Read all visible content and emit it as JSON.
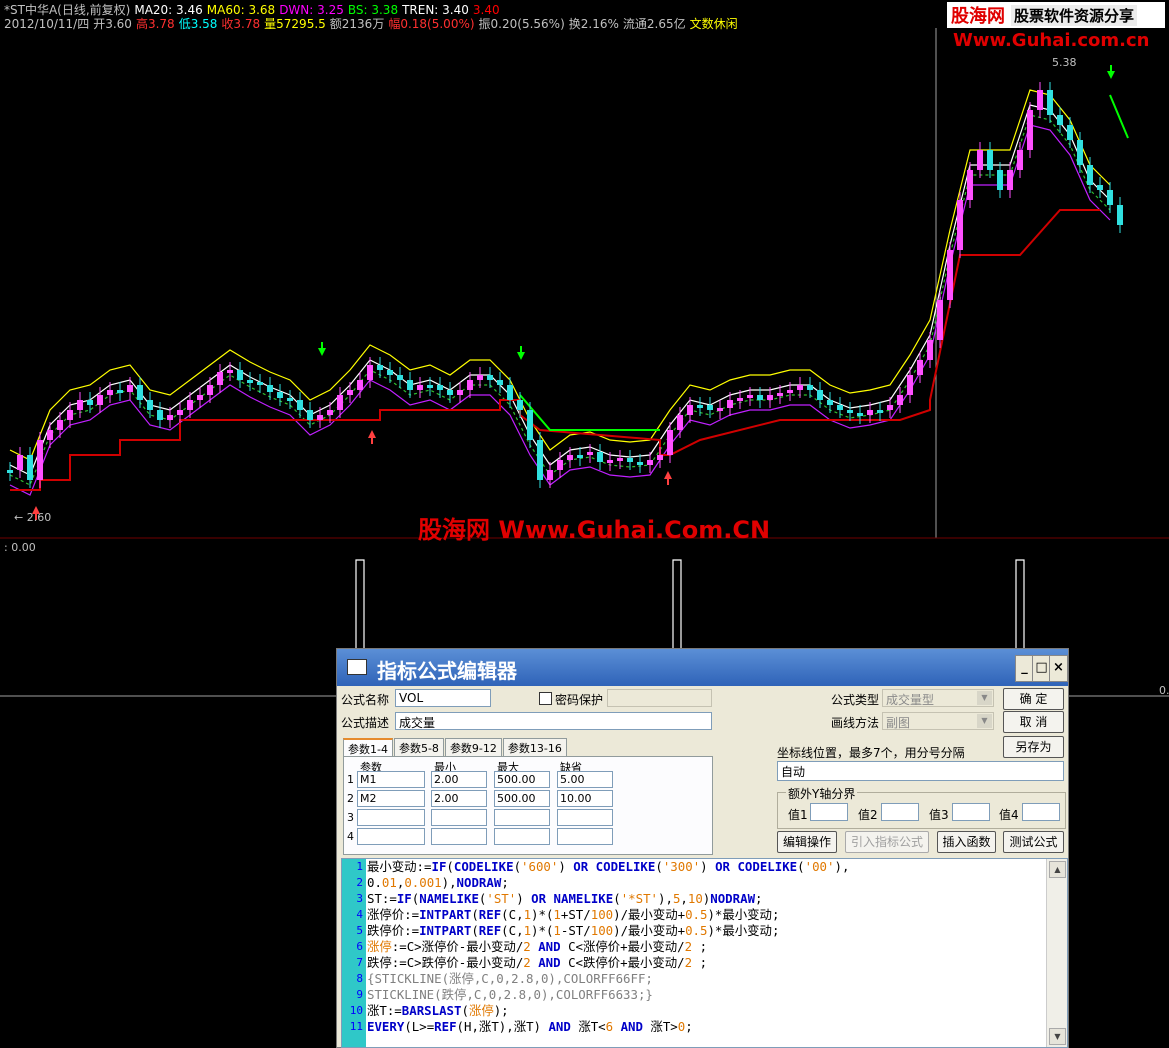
{
  "info_row1": [
    {
      "text": "*ST中华A(日线,前复权)",
      "color": "#c0c0c0"
    },
    {
      "text": "MA20: 3.46",
      "color": "#ffffff"
    },
    {
      "text": "MA60: 3.68",
      "color": "#ffff00"
    },
    {
      "text": "DWN: 3.25",
      "color": "#ff00ff"
    },
    {
      "text": "BS: 3.38",
      "color": "#00ff00"
    },
    {
      "text": "TREN: 3.40",
      "color": "#ffffff"
    },
    {
      "text": "3.40",
      "color": "#ff0000"
    }
  ],
  "info_row2": [
    {
      "text": "2012/10/11/四",
      "color": "#c0c0c0"
    },
    {
      "text": "开3.60",
      "color": "#c0c0c0"
    },
    {
      "text": "高3.78",
      "color": "#ff3030"
    },
    {
      "text": "低3.58",
      "color": "#00ffff"
    },
    {
      "text": "收3.78",
      "color": "#ff3030"
    },
    {
      "text": "量57295.5",
      "color": "#ffff00"
    },
    {
      "text": "额2136万",
      "color": "#c0c0c0"
    },
    {
      "text": "幅0.18(5.00%)",
      "color": "#ff3030"
    },
    {
      "text": "振0.20(5.56%)",
      "color": "#c0c0c0"
    },
    {
      "text": "换2.16%",
      "color": "#c0c0c0"
    },
    {
      "text": "流通2.65亿",
      "color": "#c0c0c0"
    },
    {
      "text": "文数休闲",
      "color": "#ffff00"
    }
  ],
  "brand": {
    "name": "股海网",
    "slogan": "股票软件资源分享",
    "url": "Www.Guhai.com.cn"
  },
  "watermark": "股海网 Www.Guhai.Com.CN",
  "price_high_label": "5.38",
  "price_low_label": "← 2.60",
  "sub_chart_label": ": 0.00",
  "sub_chart_right_label": "0.",
  "dialog": {
    "title": "指标公式编辑器",
    "min_btn": "_",
    "max_btn": "□",
    "close_btn": "×",
    "formula_name_label": "公式名称",
    "formula_name": "VOL",
    "password_label": "密码保护",
    "formula_desc_label": "公式描述",
    "formula_desc": "成交量",
    "formula_type_label": "公式类型",
    "formula_type": "成交量型",
    "draw_method_label": "画线方法",
    "draw_method": "副图",
    "ok": "确  定",
    "cancel": "取  消",
    "save_as": "另存为",
    "coord_label": "坐标线位置，最多7个，用分号分隔",
    "coord_value": "自动",
    "extra_y_label": "额外Y轴分界",
    "val_labels": [
      "值1",
      "值2",
      "值3",
      "值4"
    ],
    "tabs": [
      "参数1-4",
      "参数5-8",
      "参数9-12",
      "参数13-16"
    ],
    "param_headers": [
      "参数",
      "最小",
      "最大",
      "缺省"
    ],
    "params": [
      {
        "n": "1",
        "name": "M1",
        "min": "2.00",
        "max": "500.00",
        "def": "5.00"
      },
      {
        "n": "2",
        "name": "M2",
        "min": "2.00",
        "max": "500.00",
        "def": "10.00"
      },
      {
        "n": "3",
        "name": "",
        "min": "",
        "max": "",
        "def": ""
      },
      {
        "n": "4",
        "name": "",
        "min": "",
        "max": "",
        "def": ""
      }
    ],
    "buttons": [
      "编辑操作",
      "引入指标公式",
      "插入函数",
      "测试公式"
    ],
    "code_lines": [
      "最小变动:=IF(CODELIKE('600') OR CODELIKE('300') OR CODELIKE('00'),",
      "0.01,0.001),NODRAW;",
      "ST:=IF(NAMELIKE('ST') OR NAMELIKE('*ST'),5,10)NODRAW;",
      "涨停价:=INTPART(REF(C,1)*(1+ST/100)/最小变动+0.5)*最小变动;",
      "跌停价:=INTPART(REF(C,1)*(1-ST/100)/最小变动+0.5)*最小变动;",
      "涨停:=C>涨停价-最小变动/2 AND C<涨停价+最小变动/2 ;",
      "跌停:=C>跌停价-最小变动/2 AND C<跌停价+最小变动/2 ;",
      "{STICKLINE(涨停,C,0,2.8,0),COLORFF66FF;",
      "STICKLINE(跌停,C,0,2.8,0),COLORFF6633;}",
      "涨T:=BARSLAST(涨停);",
      "EVERY(L>=REF(H,涨T),涨T) AND 涨T<6 AND 涨T>0;"
    ]
  },
  "colors": {
    "bg": "#000000",
    "up": "#ff50ff",
    "down": "#30e0e0",
    "ma_white": "#ffffff",
    "ma_yellow": "#ffff00",
    "dwn": "#c020ff",
    "bs": "#00ff00",
    "tren": "#d00000"
  }
}
